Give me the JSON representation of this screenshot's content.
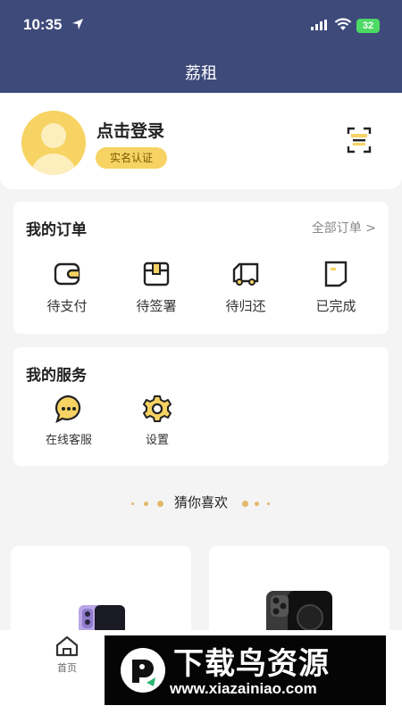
{
  "status_bar": {
    "time": "10:35",
    "battery": "32"
  },
  "nav": {
    "title": "荔租"
  },
  "profile": {
    "login_text": "点击登录",
    "verify_label": "实名认证"
  },
  "orders": {
    "title": "我的订单",
    "all_label": "全部订单 >",
    "items": [
      {
        "label": "待支付",
        "icon": "wallet-icon"
      },
      {
        "label": "待签署",
        "icon": "box-icon"
      },
      {
        "label": "待归还",
        "icon": "truck-icon"
      },
      {
        "label": "已完成",
        "icon": "document-icon"
      }
    ]
  },
  "services": {
    "title": "我的服务",
    "items": [
      {
        "label": "在线客服",
        "icon": "chat-icon"
      },
      {
        "label": "设置",
        "icon": "gear-icon"
      }
    ]
  },
  "recommend": {
    "title": "猜你喜欢"
  },
  "tabbar": {
    "home_label": "首页"
  },
  "watermark": {
    "title": "下载鸟资源",
    "url": "www.xiazainiao.com"
  },
  "colors": {
    "header": "#3d4a7a",
    "accent": "#f6d362"
  }
}
